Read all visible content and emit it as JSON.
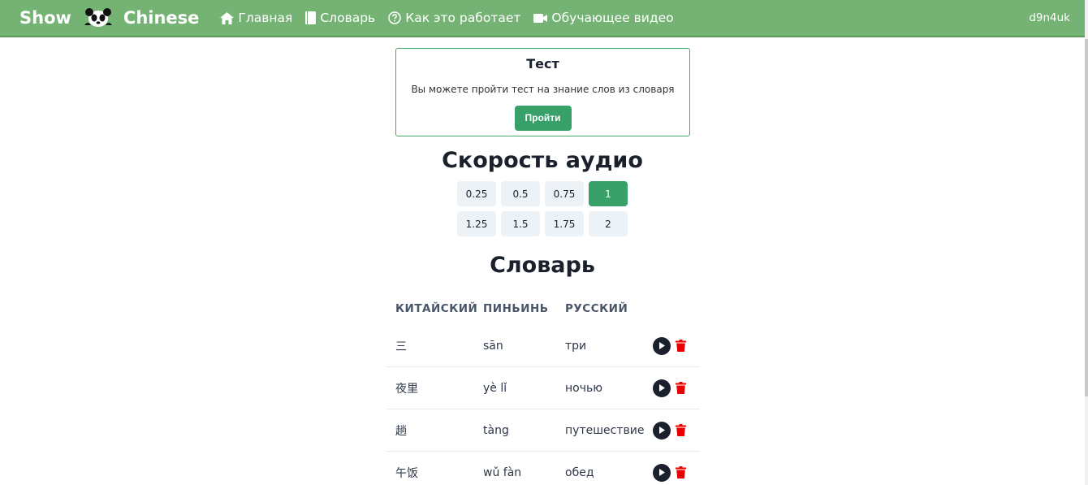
{
  "nav": {
    "brand_left": "Show",
    "brand_right": "Chinese",
    "items": [
      {
        "label": "Главная",
        "icon": "home-icon"
      },
      {
        "label": "Словарь",
        "icon": "book-icon"
      },
      {
        "label": "Как это работает",
        "icon": "question-circle-icon"
      },
      {
        "label": "Обучающее видео",
        "icon": "video-icon"
      }
    ],
    "user": "d9n4uk"
  },
  "test": {
    "title": "Тест",
    "description": "Вы можете пройти тест на знание слов из словаря",
    "button": "Пройти"
  },
  "speed": {
    "title": "Скорость аудио",
    "options": [
      "0.25",
      "0.5",
      "0.75",
      "1",
      "1.25",
      "1.5",
      "1.75",
      "2"
    ],
    "selected": "1"
  },
  "dictionary": {
    "title": "Словарь",
    "headers": [
      "КИТАЙСКИЙ",
      "ПИНЬИНЬ",
      "РУССКИЙ"
    ],
    "rows": [
      {
        "chinese": "三",
        "pinyin": "sān",
        "russian": "три"
      },
      {
        "chinese": "夜里",
        "pinyin": "yè lǐ",
        "russian": "ночью"
      },
      {
        "chinese": "趟",
        "pinyin": "tàng",
        "russian": "путешествие"
      },
      {
        "chinese": "午饭",
        "pinyin": "wǔ fàn",
        "russian": "обед"
      }
    ]
  },
  "colors": {
    "navbar": "#74b374",
    "accent": "#38a169",
    "delete": "#e53e3e"
  }
}
